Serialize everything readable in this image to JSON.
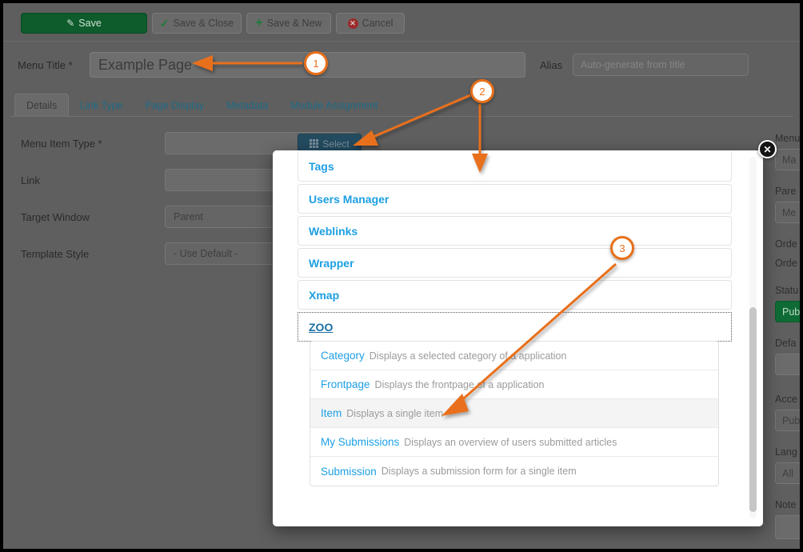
{
  "toolbar": {
    "save_label": "Save",
    "save_close_label": "Save & Close",
    "save_new_label": "Save & New",
    "cancel_label": "Cancel"
  },
  "form": {
    "menu_title_label": "Menu Title *",
    "menu_title_value": "Example Page",
    "alias_label": "Alias",
    "alias_placeholder": "Auto-generate from title",
    "menu_item_type_label": "Menu Item Type *",
    "menu_item_type_value": "",
    "link_label": "Link",
    "link_value": "",
    "target_window_label": "Target Window",
    "target_window_value": "Parent",
    "template_style_label": "Template Style",
    "template_style_value": "- Use Default -",
    "select_button_label": "Select"
  },
  "tabs": [
    {
      "label": "Details",
      "active": true
    },
    {
      "label": "Link Type",
      "active": false
    },
    {
      "label": "Page Display",
      "active": false
    },
    {
      "label": "Metadata",
      "active": false
    },
    {
      "label": "Module Assignment",
      "active": false
    }
  ],
  "sidebar": {
    "menu_label": "Menu",
    "menu_value": "Ma",
    "parent_label": "Pare",
    "parent_value": "Me",
    "ordering_label": "Orde",
    "ordering_value": "Orde",
    "status_label": "Statu",
    "status_value": "Pub",
    "default_label": "Defa",
    "default_value": "",
    "access_label": "Acce",
    "access_value": "Pub",
    "language_label": "Lang",
    "language_value": "All",
    "note_label": "Note",
    "note_value": ""
  },
  "modal": {
    "close_label": "✕",
    "items": [
      {
        "label": "Tags",
        "focused": false
      },
      {
        "label": "Users Manager",
        "focused": false
      },
      {
        "label": "Weblinks",
        "focused": false
      },
      {
        "label": "Wrapper",
        "focused": false
      },
      {
        "label": "Xmap",
        "focused": false
      },
      {
        "label": "ZOO",
        "focused": true
      }
    ],
    "sub_items": [
      {
        "name": "Category",
        "desc": "Displays a selected category of a application",
        "highlighted": false
      },
      {
        "name": "Frontpage",
        "desc": "Displays the frontpage of a application",
        "highlighted": false
      },
      {
        "name": "Item",
        "desc": "Displays a single item",
        "highlighted": true
      },
      {
        "name": "My Submissions",
        "desc": "Displays an overview of users submitted articles",
        "highlighted": false
      },
      {
        "name": "Submission",
        "desc": "Displays a submission form for a single item",
        "highlighted": false
      }
    ]
  },
  "annotations": [
    {
      "number": "1"
    },
    {
      "number": "2"
    },
    {
      "number": "3"
    }
  ],
  "colors": {
    "accent_orange": "#e8701a",
    "link_blue": "#1d9fe3",
    "green": "#0e5b2c"
  }
}
